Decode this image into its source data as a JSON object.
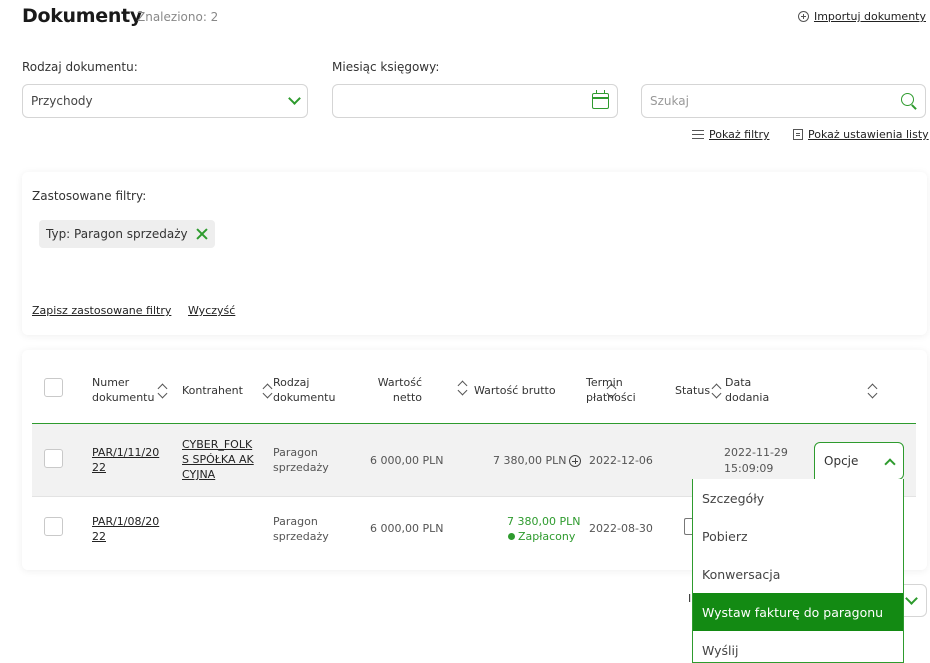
{
  "header": {
    "title": "Dokumenty",
    "count": "Znaleziono: 2",
    "import_label": "Importuj dokumenty"
  },
  "filters": {
    "doc_type": {
      "label": "Rodzaj dokumentu:",
      "value": "Przychody"
    },
    "month": {
      "label": "Miesiąc księgowy:",
      "value": ""
    },
    "search": {
      "placeholder": "Szukaj"
    },
    "show_filters": "Pokaż filtry",
    "show_list_settings": "Pokaż ustawienia listy"
  },
  "applied": {
    "label": "Zastosowane filtry:",
    "chip": "Typ: Paragon sprzedaży",
    "save": "Zapisz zastosowane filtry",
    "clear": "Wyczyść"
  },
  "table": {
    "headers": {
      "number": "Numer dokumentu",
      "contractor": "Kontrahent",
      "type": "Rodzaj dokumentu",
      "net": "Wartość netto",
      "gross": "Wartość brutto",
      "due": "Termin płatności",
      "status": "Status",
      "added": "Data dodania"
    },
    "rows": [
      {
        "number": "PAR/1/11/2022",
        "contractor": "CYBER_FOLKS SPÓŁKA AKCYJNA",
        "type": "Paragon sprzedaży",
        "net": "6 000,00 PLN",
        "gross": "7 380,00 PLN",
        "due": "2022-12-06",
        "added_date": "2022-11-29",
        "added_time": "15:09:09"
      },
      {
        "number": "PAR/1/08/2022",
        "contractor": "",
        "type": "Paragon sprzedaży",
        "net": "6 000,00 PLN",
        "gross": "7 380,00 PLN",
        "paid": "Zapłacony",
        "due": "2022-08-30"
      }
    ]
  },
  "options": {
    "button": "Opcje",
    "items": [
      "Szczegóły",
      "Pobierz",
      "Konwersacja",
      "Wystaw fakturę do paragonu",
      "Wyślij"
    ]
  },
  "colors": {
    "accent": "#2e9b2e",
    "active_menu": "#138a13"
  }
}
